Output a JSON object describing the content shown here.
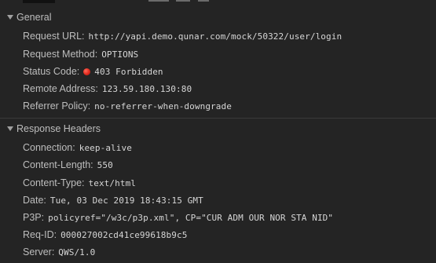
{
  "general": {
    "title": "General",
    "rows": [
      {
        "key": "Request URL:",
        "value": "http://yapi.demo.qunar.com/mock/50322/user/login"
      },
      {
        "key": "Request Method:",
        "value": "OPTIONS"
      },
      {
        "key": "Status Code:",
        "value": "403 Forbidden",
        "status_color": "#e0281c"
      },
      {
        "key": "Remote Address:",
        "value": "123.59.180.130:80"
      },
      {
        "key": "Referrer Policy:",
        "value": "no-referrer-when-downgrade"
      }
    ]
  },
  "response_headers": {
    "title": "Response Headers",
    "rows": [
      {
        "key": "Connection:",
        "value": "keep-alive"
      },
      {
        "key": "Content-Length:",
        "value": "550"
      },
      {
        "key": "Content-Type:",
        "value": "text/html"
      },
      {
        "key": "Date:",
        "value": "Tue, 03 Dec 2019 18:43:15 GMT"
      },
      {
        "key": "P3P:",
        "value": "policyref=\"/w3c/p3p.xml\", CP=\"CUR ADM OUR NOR STA NID\""
      },
      {
        "key": "Req-ID:",
        "value": "000027002cd41ce99618b9c5"
      },
      {
        "key": "Server:",
        "value": "QWS/1.0"
      }
    ]
  }
}
